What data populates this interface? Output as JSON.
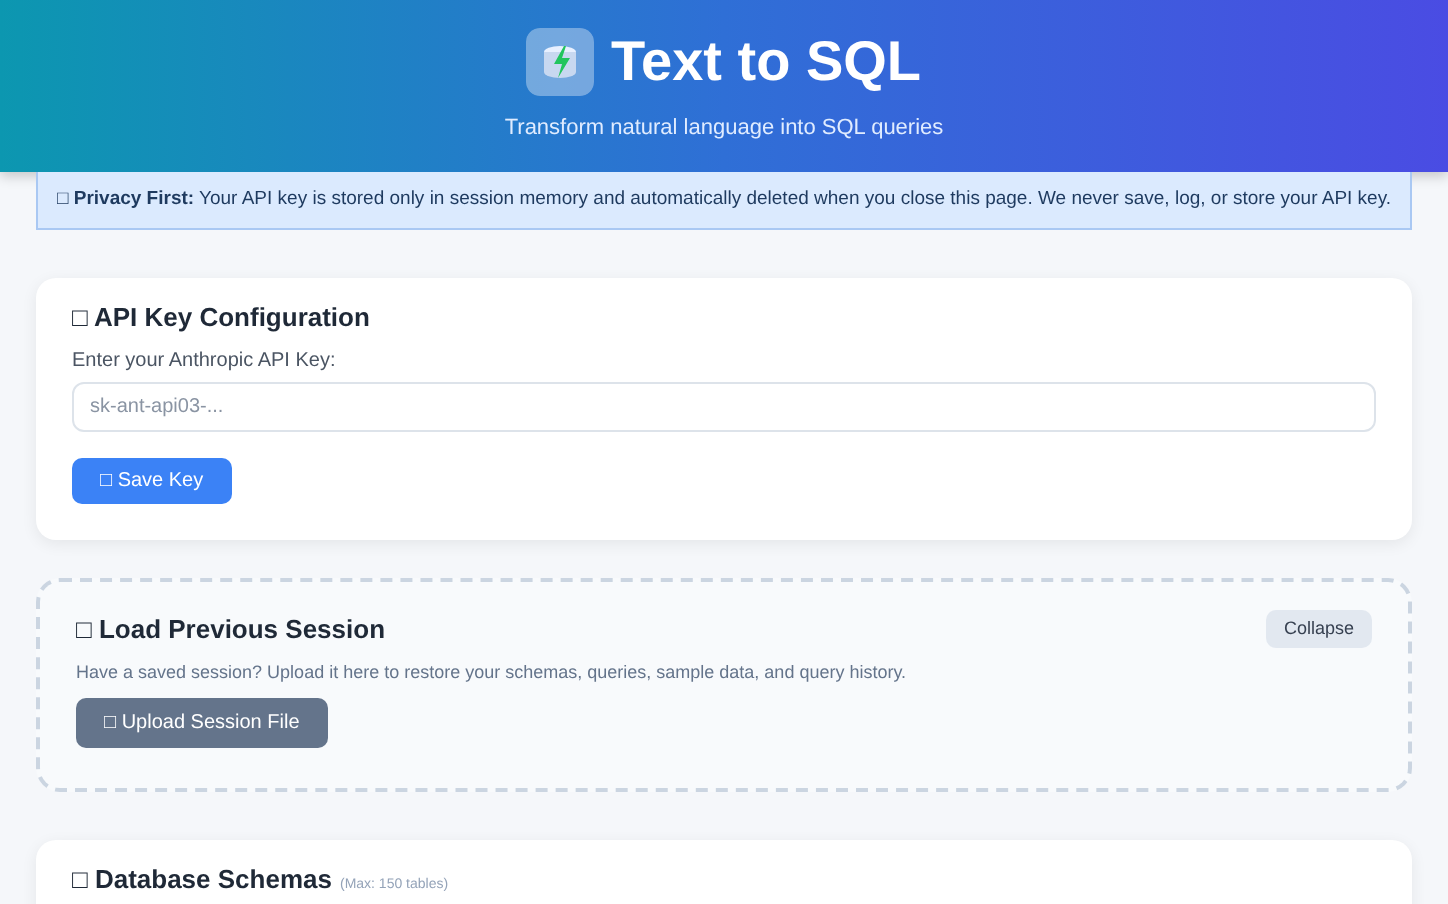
{
  "header": {
    "title": "Text to SQL",
    "subtitle": "Transform natural language into SQL queries"
  },
  "privacy_notice": {
    "icon": "□",
    "label": "Privacy First:",
    "text": "Your API key is stored only in session memory and automatically deleted when you close this page. We never save, log, or store your API key."
  },
  "api_key_card": {
    "icon": "□",
    "title": "API Key Configuration",
    "field_label": "Enter your Anthropic API Key:",
    "placeholder": "sk-ant-api03-...",
    "button": {
      "icon": "□",
      "label": "Save Key"
    }
  },
  "session_card": {
    "icon": "□",
    "title": "Load Previous Session",
    "collapse_button": "Collapse",
    "description": "Have a saved session? Upload it here to restore your schemas, queries, sample data, and query history.",
    "button": {
      "icon": "□",
      "label": "Upload Session File"
    }
  },
  "schemas_card": {
    "icon": "□",
    "title": "Database Schemas",
    "note": "(Max: 150 tables)"
  }
}
